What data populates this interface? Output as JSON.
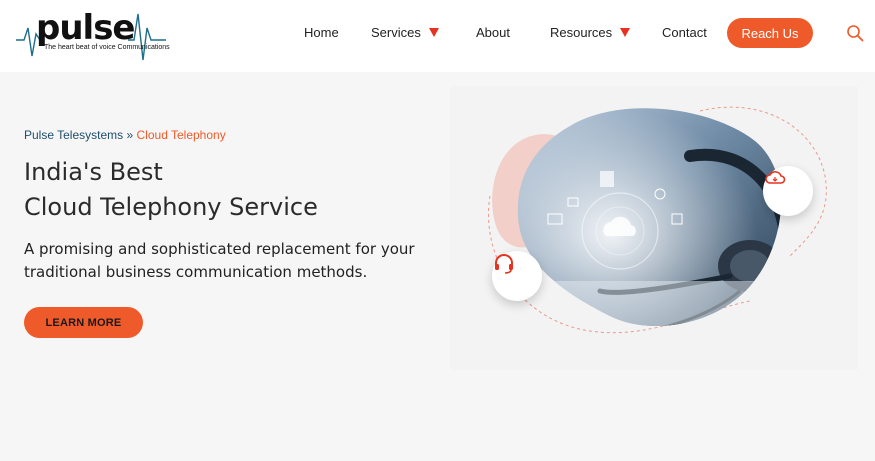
{
  "logo": {
    "word": "pulse",
    "tagline": "The heart beat of voice Communications",
    "icon": "heartbeat-line-icon"
  },
  "nav": {
    "items": [
      {
        "label": "Home",
        "dropdown": false
      },
      {
        "label": "Services",
        "dropdown": true
      },
      {
        "label": "About",
        "dropdown": false
      },
      {
        "label": "Resources",
        "dropdown": true
      },
      {
        "label": "Contact",
        "dropdown": false
      }
    ],
    "cta_label": "Reach Us",
    "search_icon": "search-icon"
  },
  "hero": {
    "breadcrumb": {
      "root": "Pulse Telesystems",
      "separator": "»",
      "current": "Cloud Telephony"
    },
    "title_line1": "India's Best",
    "title_line2": "Cloud Telephony Service",
    "subtitle": "A promising and sophisticated replacement for your traditional business communication methods.",
    "button_label": "LEARN MORE"
  },
  "illustration": {
    "bubble_left_icon": "headset-icon",
    "bubble_right_icon": "cloud-icon"
  },
  "colors": {
    "accent": "#ef5a2a",
    "caret": "#e6321e",
    "breadcrumb_link": "#1f4e6b",
    "page_bg": "#f6f6f6",
    "header_bg": "#ffffff"
  }
}
